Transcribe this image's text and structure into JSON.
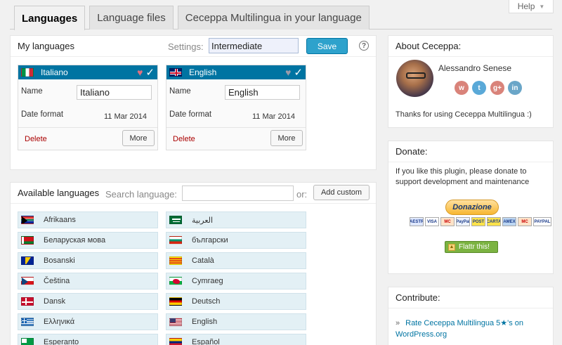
{
  "help": {
    "label": "Help"
  },
  "tabs": [
    {
      "label": "Languages",
      "active": true
    },
    {
      "label": "Language files",
      "active": false
    },
    {
      "label": "Ceceppa Multilingua in your language",
      "active": false
    }
  ],
  "my_languages": {
    "title": "My languages",
    "settings_label": "Settings:",
    "settings_value": "Intermediate",
    "save_label": "Save",
    "help_glyph": "?",
    "cards": [
      {
        "language": "Italiano",
        "flag": "it",
        "default": true,
        "name_label": "Name",
        "name_value": "Italiano",
        "date_label": "Date format",
        "date_value": "11 Mar 2014",
        "delete_label": "Delete",
        "more_label": "More"
      },
      {
        "language": "English",
        "flag": "gb",
        "default": false,
        "name_label": "Name",
        "name_value": "English",
        "date_label": "Date format",
        "date_value": "11 Mar 2014",
        "delete_label": "Delete",
        "more_label": "More"
      }
    ]
  },
  "available_languages": {
    "title": "Available languages",
    "search_label": "Search language:",
    "search_value": "",
    "or_label": "or:",
    "add_custom_label": "Add custom",
    "items": [
      {
        "label": "Afrikaans",
        "flag": "za"
      },
      {
        "label": "العربية",
        "flag": "sa"
      },
      {
        "label": "Беларуская мова",
        "flag": "by"
      },
      {
        "label": "български",
        "flag": "bg"
      },
      {
        "label": "Bosanski",
        "flag": "ba"
      },
      {
        "label": "Català",
        "flag": "cat"
      },
      {
        "label": "Čeština",
        "flag": "cz"
      },
      {
        "label": "Cymraeg",
        "flag": "wales"
      },
      {
        "label": "Dansk",
        "flag": "dk"
      },
      {
        "label": "Deutsch",
        "flag": "de"
      },
      {
        "label": "Ελληνικά",
        "flag": "gr"
      },
      {
        "label": "English",
        "flag": "us"
      },
      {
        "label": "Esperanto",
        "flag": "eo"
      },
      {
        "label": "Español",
        "flag": "ve"
      }
    ]
  },
  "about": {
    "title": "About Ceceppa:",
    "author": "Alessandro Senese",
    "social": [
      {
        "glyph": "w",
        "color": "#d9837a"
      },
      {
        "glyph": "t",
        "color": "#5aa9d8"
      },
      {
        "glyph": "g+",
        "color": "#d9837a"
      },
      {
        "glyph": "in",
        "color": "#6aa6c8"
      }
    ],
    "thanks": "Thanks for using Ceceppa Multilingua :)"
  },
  "donate": {
    "title": "Donate:",
    "text": "If you like this plugin, please donate to support development and maintenance",
    "paypal_label": "Donazione",
    "cards": [
      "MAESTRO",
      "VISA",
      "MC",
      "PayPal",
      "POST",
      "CARTA",
      "AMEX",
      "MC",
      "PAYPAL"
    ],
    "flattr_label": "Flattr this!"
  },
  "contribute": {
    "title": "Contribute:",
    "bullet": "»",
    "link": "Rate Ceceppa Multilingua 5★'s on WordPress.org"
  }
}
